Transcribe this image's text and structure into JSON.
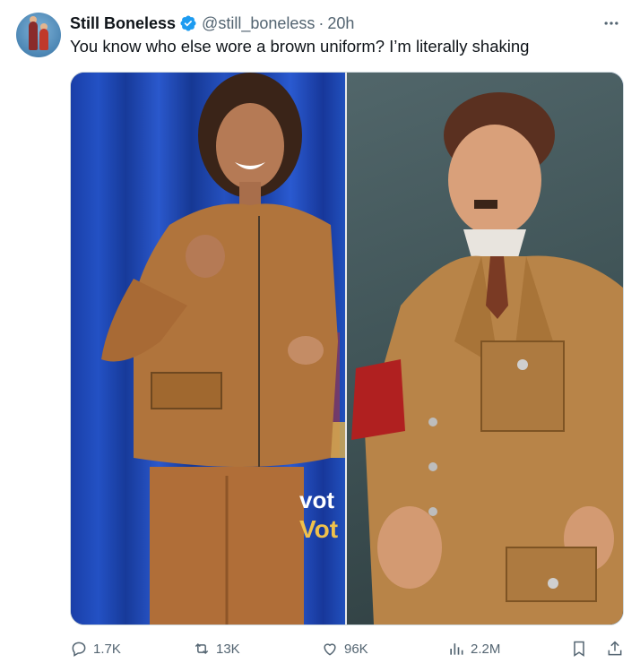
{
  "post": {
    "display_name": "Still Boneless",
    "handle": "@still_boneless",
    "separator": "·",
    "time": "20h",
    "text": "You know who else wore a brown uniform? I’m literally shaking"
  },
  "media": {
    "overlay_line1": "vot",
    "overlay_line2": "Vot"
  },
  "actions": {
    "replies": "1.7K",
    "reposts": "13K",
    "likes": "96K",
    "views": "2.2M"
  },
  "colors": {
    "verified_badge": "#1d9bf0",
    "secondary_text": "#536471",
    "overlay_yellow": "#f0c14b"
  },
  "icons": [
    "verified-badge-icon",
    "more-icon",
    "reply-icon",
    "repost-icon",
    "like-icon",
    "views-icon",
    "bookmark-icon",
    "share-icon"
  ]
}
